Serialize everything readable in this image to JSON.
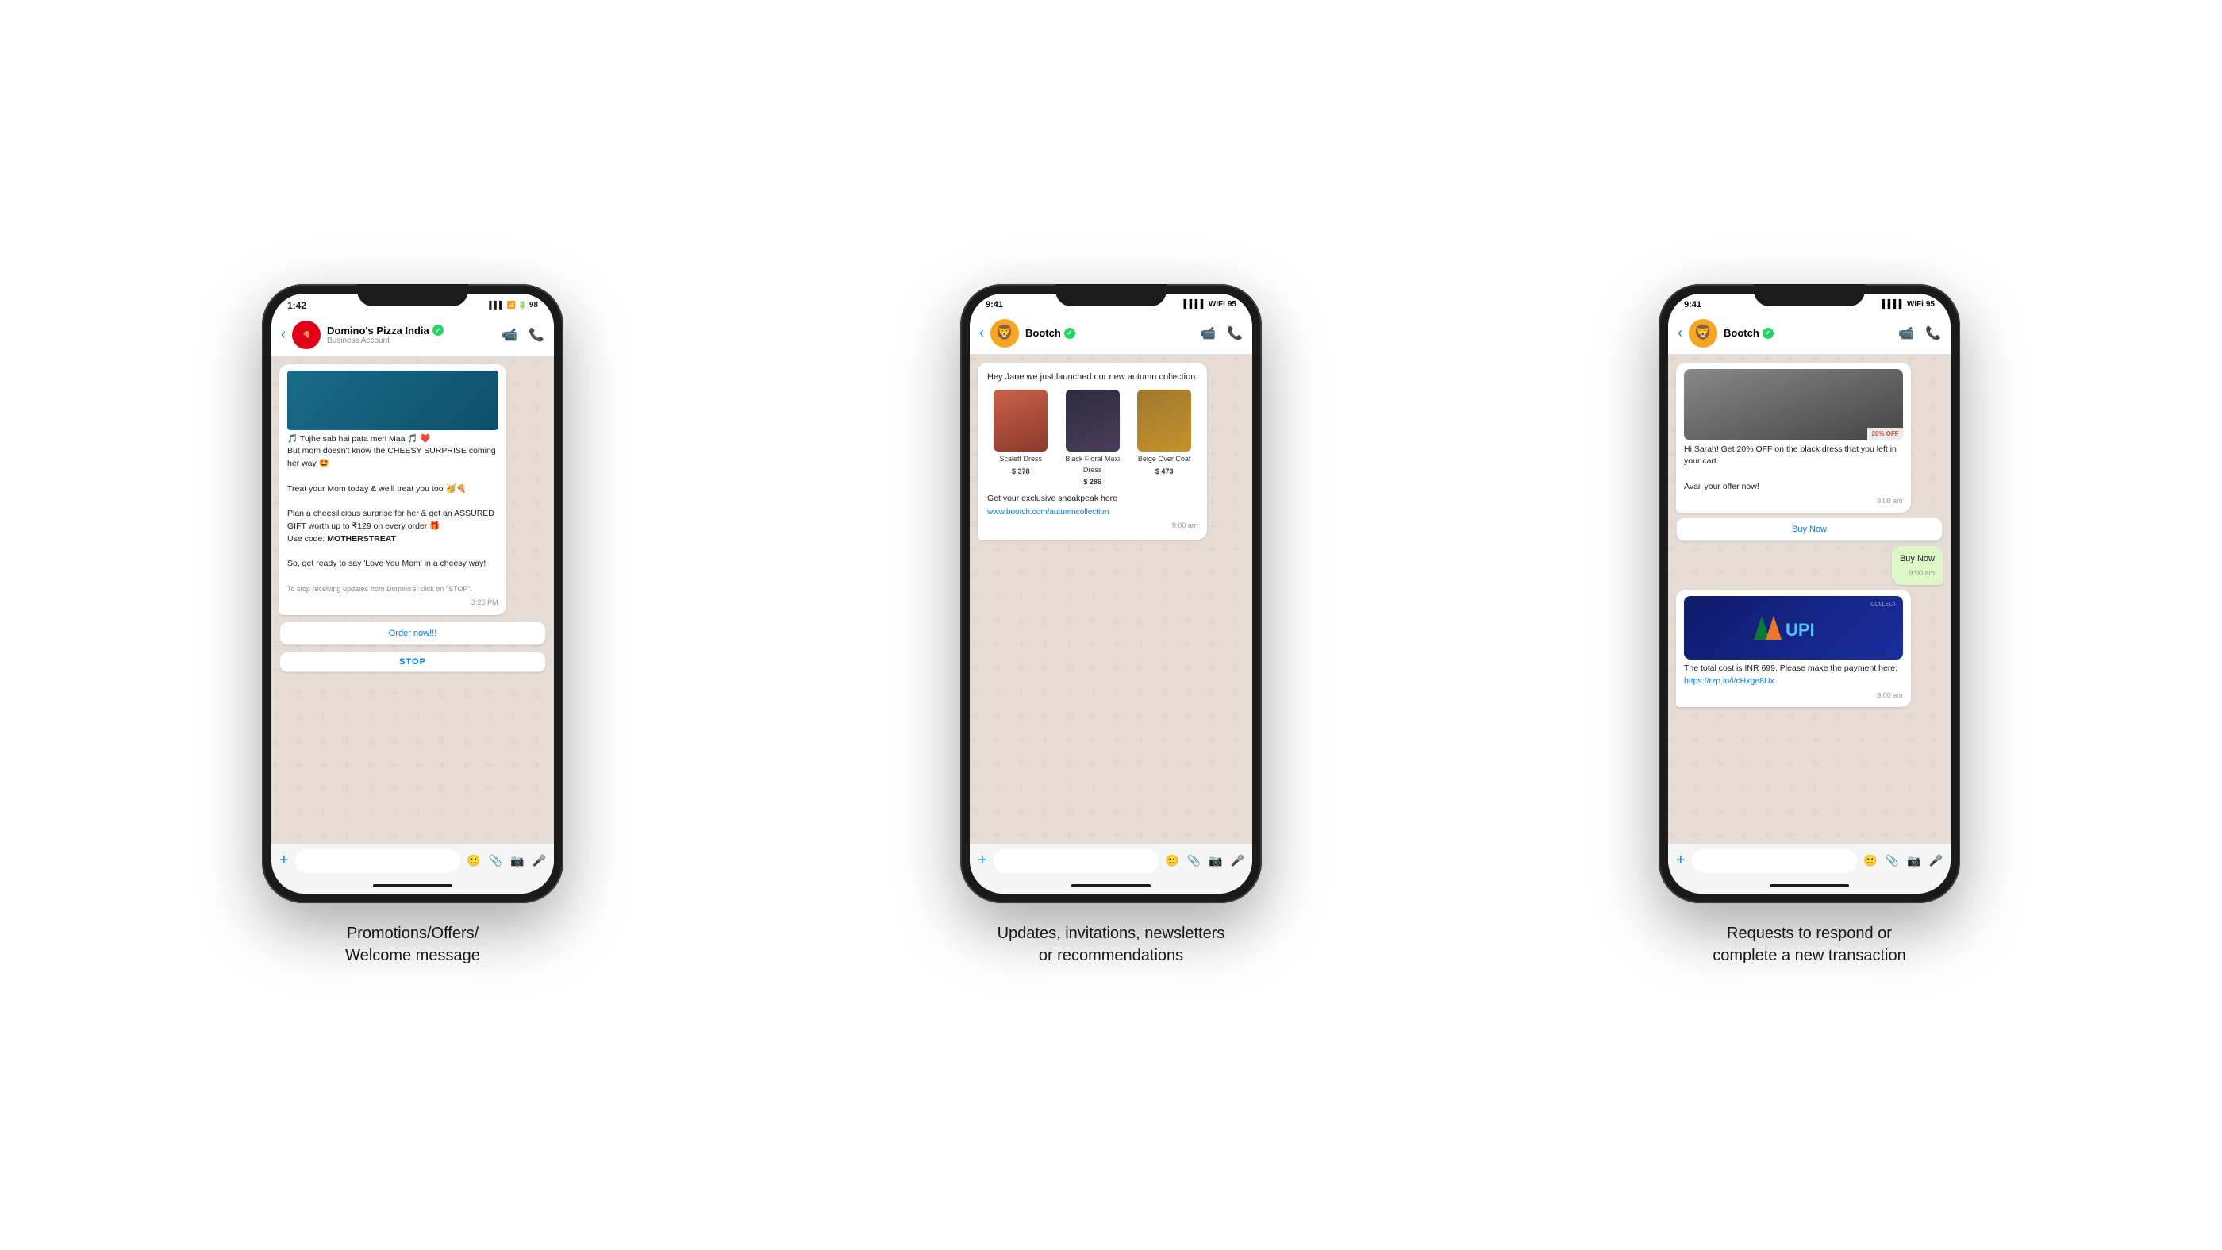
{
  "page": {
    "background": "#ffffff"
  },
  "phones": [
    {
      "id": "dominos",
      "status_bar": {
        "time": "1:42",
        "battery": "98"
      },
      "header": {
        "name": "Domino's Pizza India",
        "sub": "Business Account",
        "verified": true
      },
      "messages": [
        {
          "type": "received",
          "has_image": true,
          "text": "🎵 Tujhe sab hai pata meri Maa 🎵 ❤️\nBut mom doesn't know the CHEESY SURPRISE coming her way 🤩\n\nTreat your Mom today & we'll treat you too 🥳🍕\n\nPlan a cheesilicious surprise for her & get an ASSURED GIFT worth up to ₹129 on every order 🎁\nUse code: MOTHERSTREAT\n\nSo, get ready to say 'Love You Mom' in a cheesy way!\n\nTo stop receiving updates from Domino's, click on \"STOP\".",
          "time": "3:26 PM"
        }
      ],
      "buttons": [
        {
          "label": "Order now!!!",
          "type": "action"
        },
        {
          "label": "STOP",
          "type": "stop"
        }
      ],
      "caption": "Promotions/Offers/\nWelcome message"
    },
    {
      "id": "bootch-updates",
      "status_bar": {
        "time": "9:41",
        "battery": "95"
      },
      "header": {
        "name": "Bootch",
        "verified": true
      },
      "messages": [
        {
          "type": "received",
          "intro": "Hey Jane we just launched our new autumn collection.",
          "products": [
            {
              "name": "Scalett Dress",
              "price": "$ 378",
              "color1": "#c9614a",
              "color2": "#8b3a2a"
            },
            {
              "name": "Black Floral Maxi Dress",
              "price": "$ 286",
              "color1": "#2c2c3e",
              "color2": "#4a3d5c"
            },
            {
              "name": "Beige Over Coat",
              "price": "$ 473",
              "color1": "#8b6914",
              "color2": "#c4922a"
            }
          ],
          "link_text": "Get your exclusive sneakpeak here",
          "link": "www.bootch.com/autumncollection",
          "time": "9:00 am"
        }
      ],
      "caption": "Updates, invitations, newsletters\nor recommendations"
    },
    {
      "id": "bootch-transaction",
      "status_bar": {
        "time": "9:41",
        "battery": "95"
      },
      "header": {
        "name": "Bootch",
        "verified": true
      },
      "messages": [
        {
          "type": "received",
          "has_dress_image": true,
          "discount_badge": "20% OFF",
          "text": "Hi Sarah! Get 20% OFF on the black dress that you left in your cart.\n\nAvail your offer now!",
          "time": "9:00 am"
        },
        {
          "type": "action_button",
          "label": "Buy Now"
        },
        {
          "type": "sent",
          "text": "Buy Now",
          "time": "9:00 am"
        },
        {
          "type": "received",
          "has_upi": true,
          "text": "The total cost is INR 699. Please make the payment here: ",
          "link": "https://rzp.io/i/cHxge8Ux",
          "time": "9:00 am"
        }
      ],
      "caption": "Requests to respond or\ncomplete a new transaction"
    }
  ]
}
